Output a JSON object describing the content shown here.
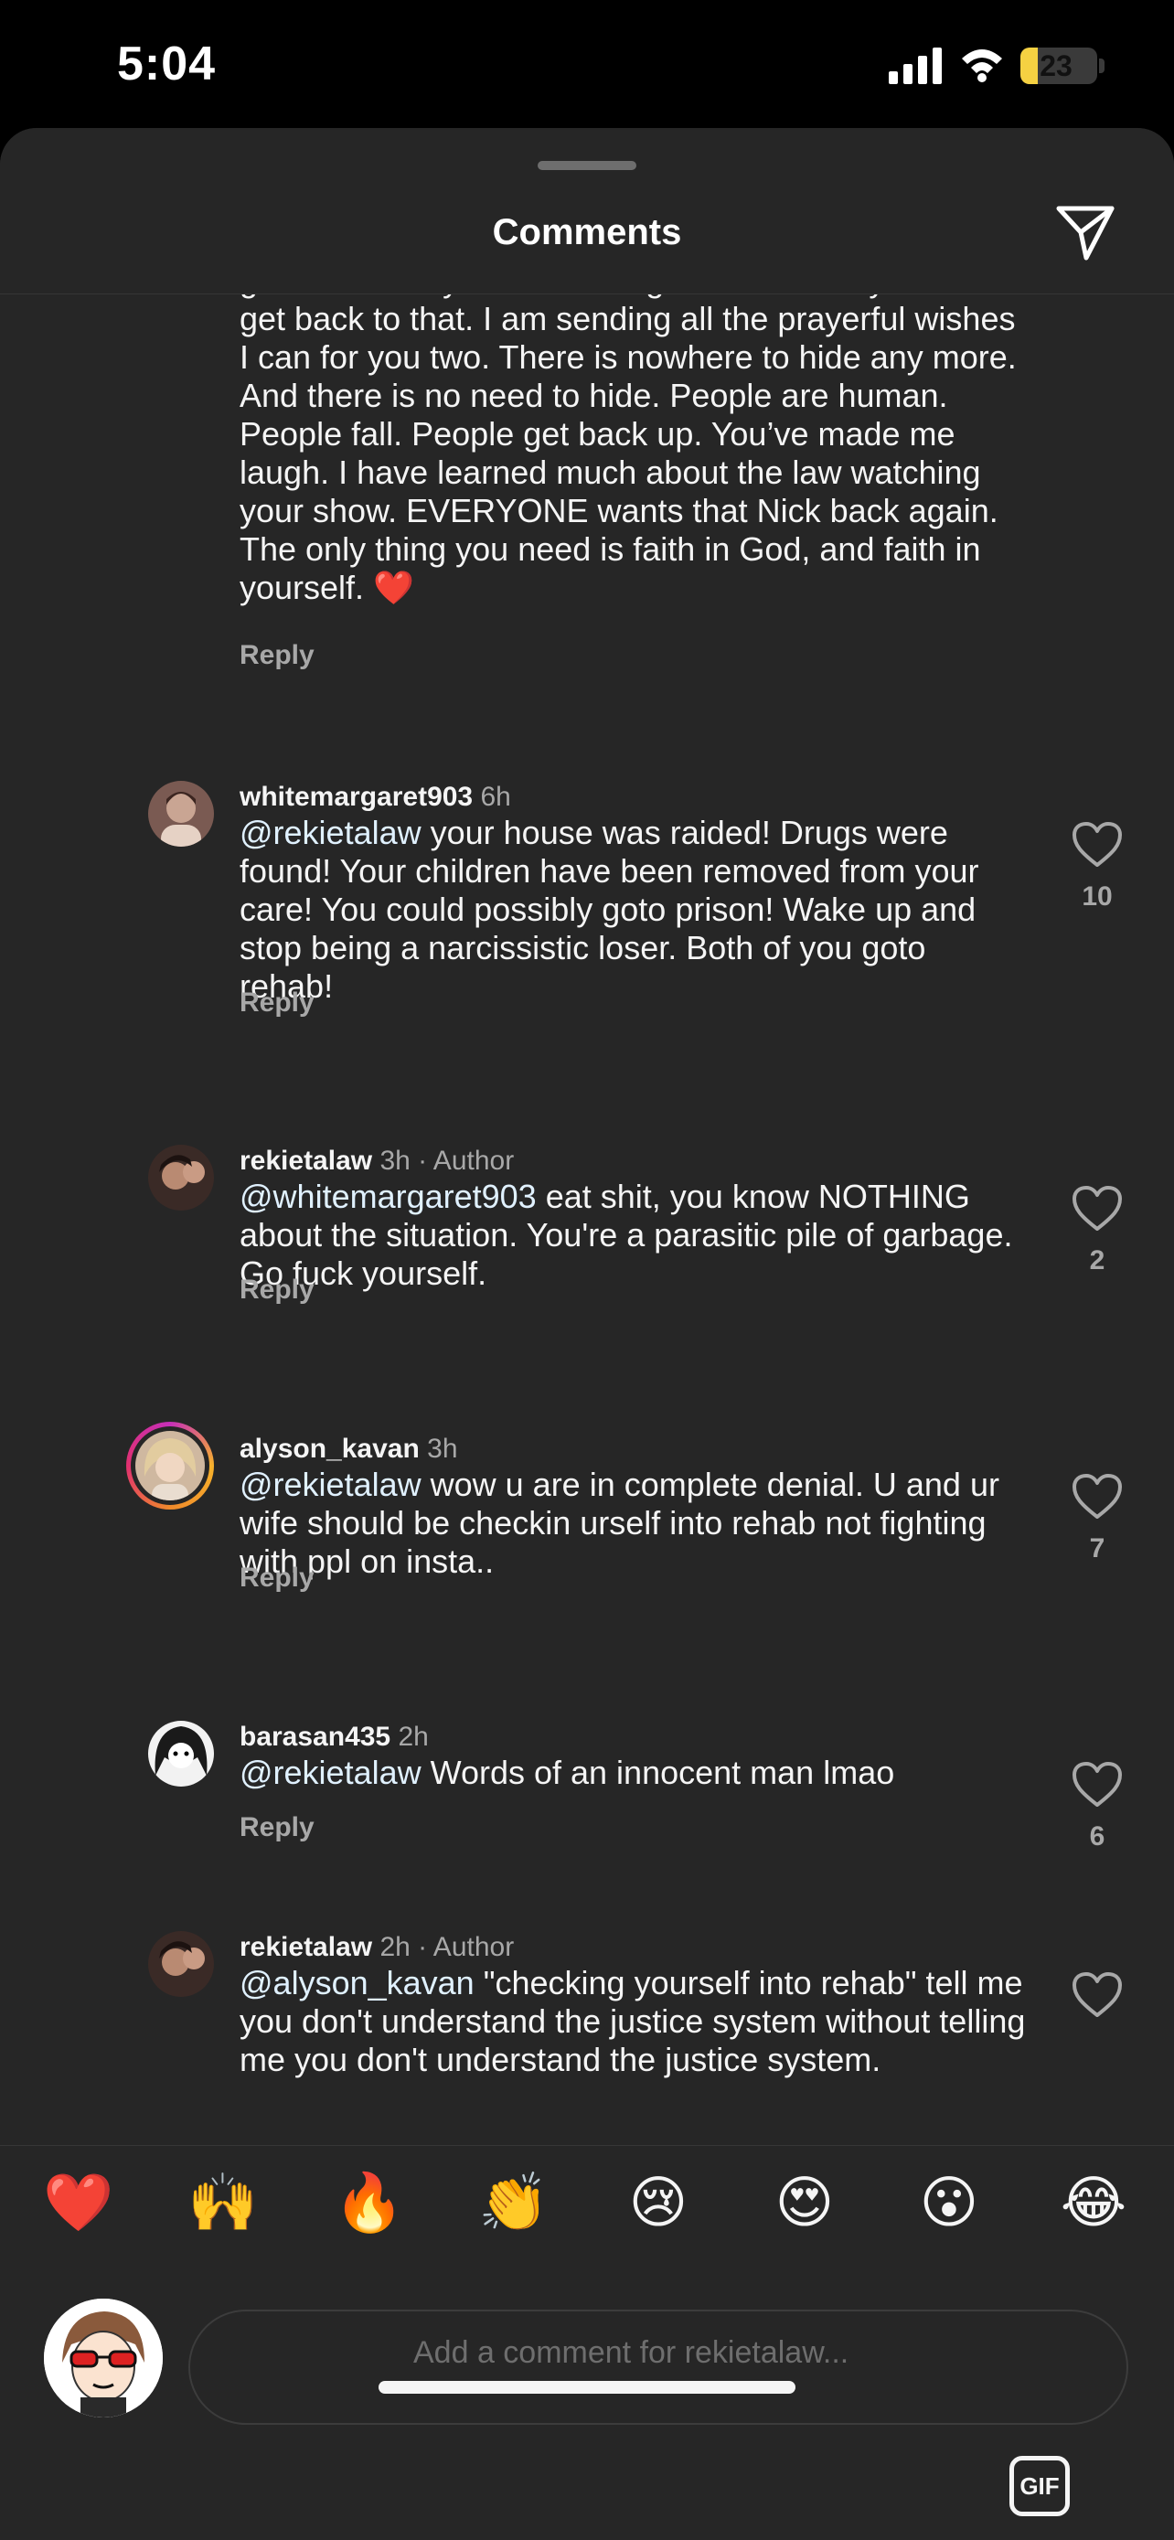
{
  "status_bar": {
    "time": "5:04",
    "battery": "23",
    "battery_level": 0.23
  },
  "header": {
    "title": "Comments",
    "share_icon": "paper-plane-icon",
    "grabber_icon": "sheet-grabber"
  },
  "comments": [
    {
      "text": "great Dad. Kayla an amazing Mom. I know you can get back to that. I am sending all the prayerful wishes I can for you two. There is nowhere to hide any more. And there is no need to hide. People are human. People fall. People get back up. You’ve made me laugh. I have learned much about the law watching your show. EVERYONE wants that Nick back again. The only thing you need is faith in God, and faith in yourself. ❤️",
      "reply": "Reply"
    },
    {
      "username": "whitemargaret903",
      "time": "6h",
      "mention": "@rekietalaw",
      "text": " your house was raided! Drugs were found! Your children have been removed from your care! You could possibly goto prison! Wake up and stop being a narcissistic loser. Both of you goto rehab!",
      "reply": "Reply",
      "likes": "10"
    },
    {
      "username": "rekietalaw",
      "time": "3h · Author",
      "mention": "@whitemargaret903",
      "text": " eat shit, you know NOTHING about the situation.  You're a parasitic pile of garbage.  Go fuck yourself.",
      "reply": "Reply",
      "likes": "2"
    },
    {
      "username": "alyson_kavan",
      "time": "3h",
      "mention": "@rekietalaw",
      "text": " wow u are in complete denial. U and ur wife should be checkin urself into rehab not fighting with ppl on insta..",
      "reply": "Reply",
      "likes": "7"
    },
    {
      "username": "barasan435",
      "time": "2h",
      "mention": "@rekietalaw",
      "text": " Words of an innocent man lmao",
      "reply": "Reply",
      "likes": "6"
    },
    {
      "username": "rekietalaw",
      "time": "2h · Author",
      "mention": "@alyson_kavan",
      "text": " \"checking yourself into rehab\" tell me you don't understand the justice system without telling me you don't understand the justice system."
    }
  ],
  "reactions": [
    "❤️",
    "🙌",
    "🔥",
    "👏",
    "😢",
    "😍",
    "😮",
    "😂"
  ],
  "composer": {
    "placeholder": "Add a comment for rekietalaw...",
    "gif_label": "GIF"
  },
  "colors": {
    "background": "#262626",
    "text": "#f5f5f5",
    "secondary": "#a8a8a8",
    "mention": "#e0f1ff",
    "battery": "#f5d142"
  }
}
